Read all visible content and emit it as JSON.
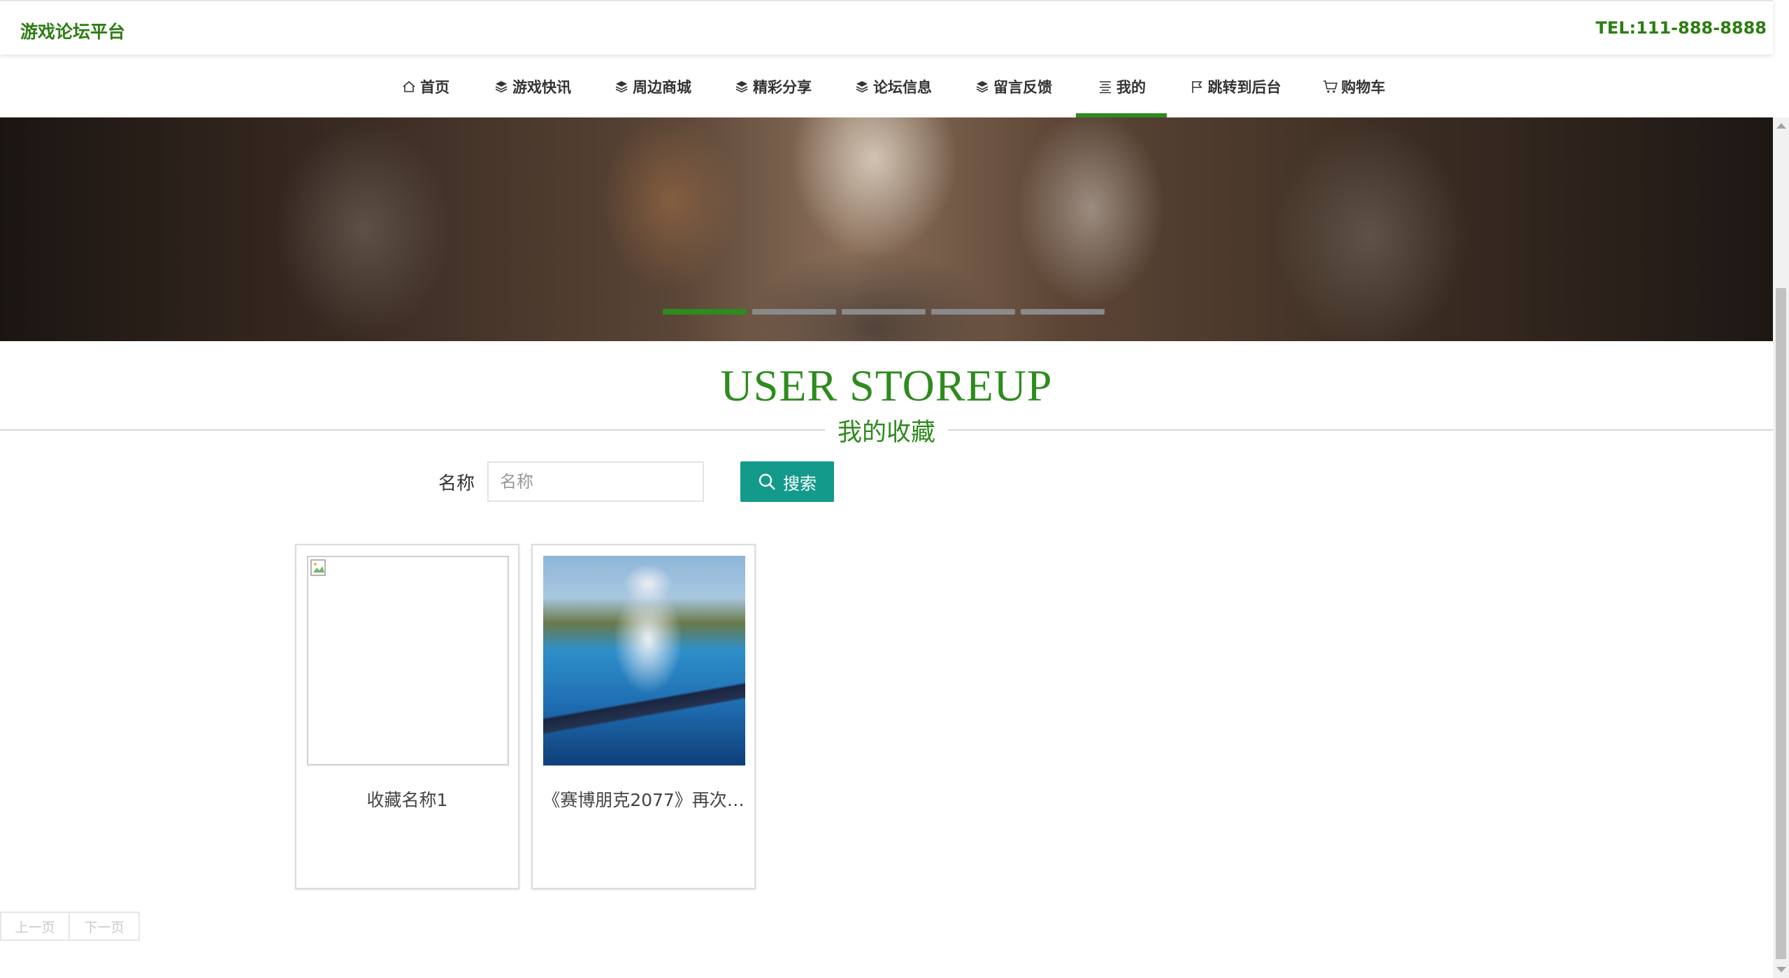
{
  "header": {
    "brand": "游戏论坛平台",
    "tel": "TEL:111-888-8888"
  },
  "nav": {
    "items": [
      {
        "label": "首页",
        "icon": "home-icon"
      },
      {
        "label": "游戏快讯",
        "icon": "layers-icon"
      },
      {
        "label": "周边商城",
        "icon": "layers-icon"
      },
      {
        "label": "精彩分享",
        "icon": "layers-icon"
      },
      {
        "label": "论坛信息",
        "icon": "layers-icon"
      },
      {
        "label": "留言反馈",
        "icon": "layers-icon"
      },
      {
        "label": "我的",
        "icon": "list-icon",
        "active": true
      },
      {
        "label": "跳转到后台",
        "icon": "flag-icon"
      },
      {
        "label": "购物车",
        "icon": "cart-icon"
      }
    ],
    "active_index": 6
  },
  "banner": {
    "slide_count": 5,
    "active_slide": 1,
    "accent_color": "#2e8b1e"
  },
  "section": {
    "title": "USER STOREUP",
    "subtitle": "我的收藏"
  },
  "search": {
    "label": "名称",
    "placeholder": "名称",
    "value": "",
    "button_label": "搜索",
    "button_icon": "search-icon",
    "button_color": "#139a8a"
  },
  "favorites": [
    {
      "name": "收藏名称1",
      "image": "broken-image"
    },
    {
      "name": "《赛博朋克2077》再次…",
      "image": "game-character-art"
    }
  ],
  "pagination": {
    "prev_label": "上一页",
    "next_label": "下一页"
  },
  "colors": {
    "brand_green": "#2e7d14",
    "accent_green": "#2e8b1e"
  }
}
